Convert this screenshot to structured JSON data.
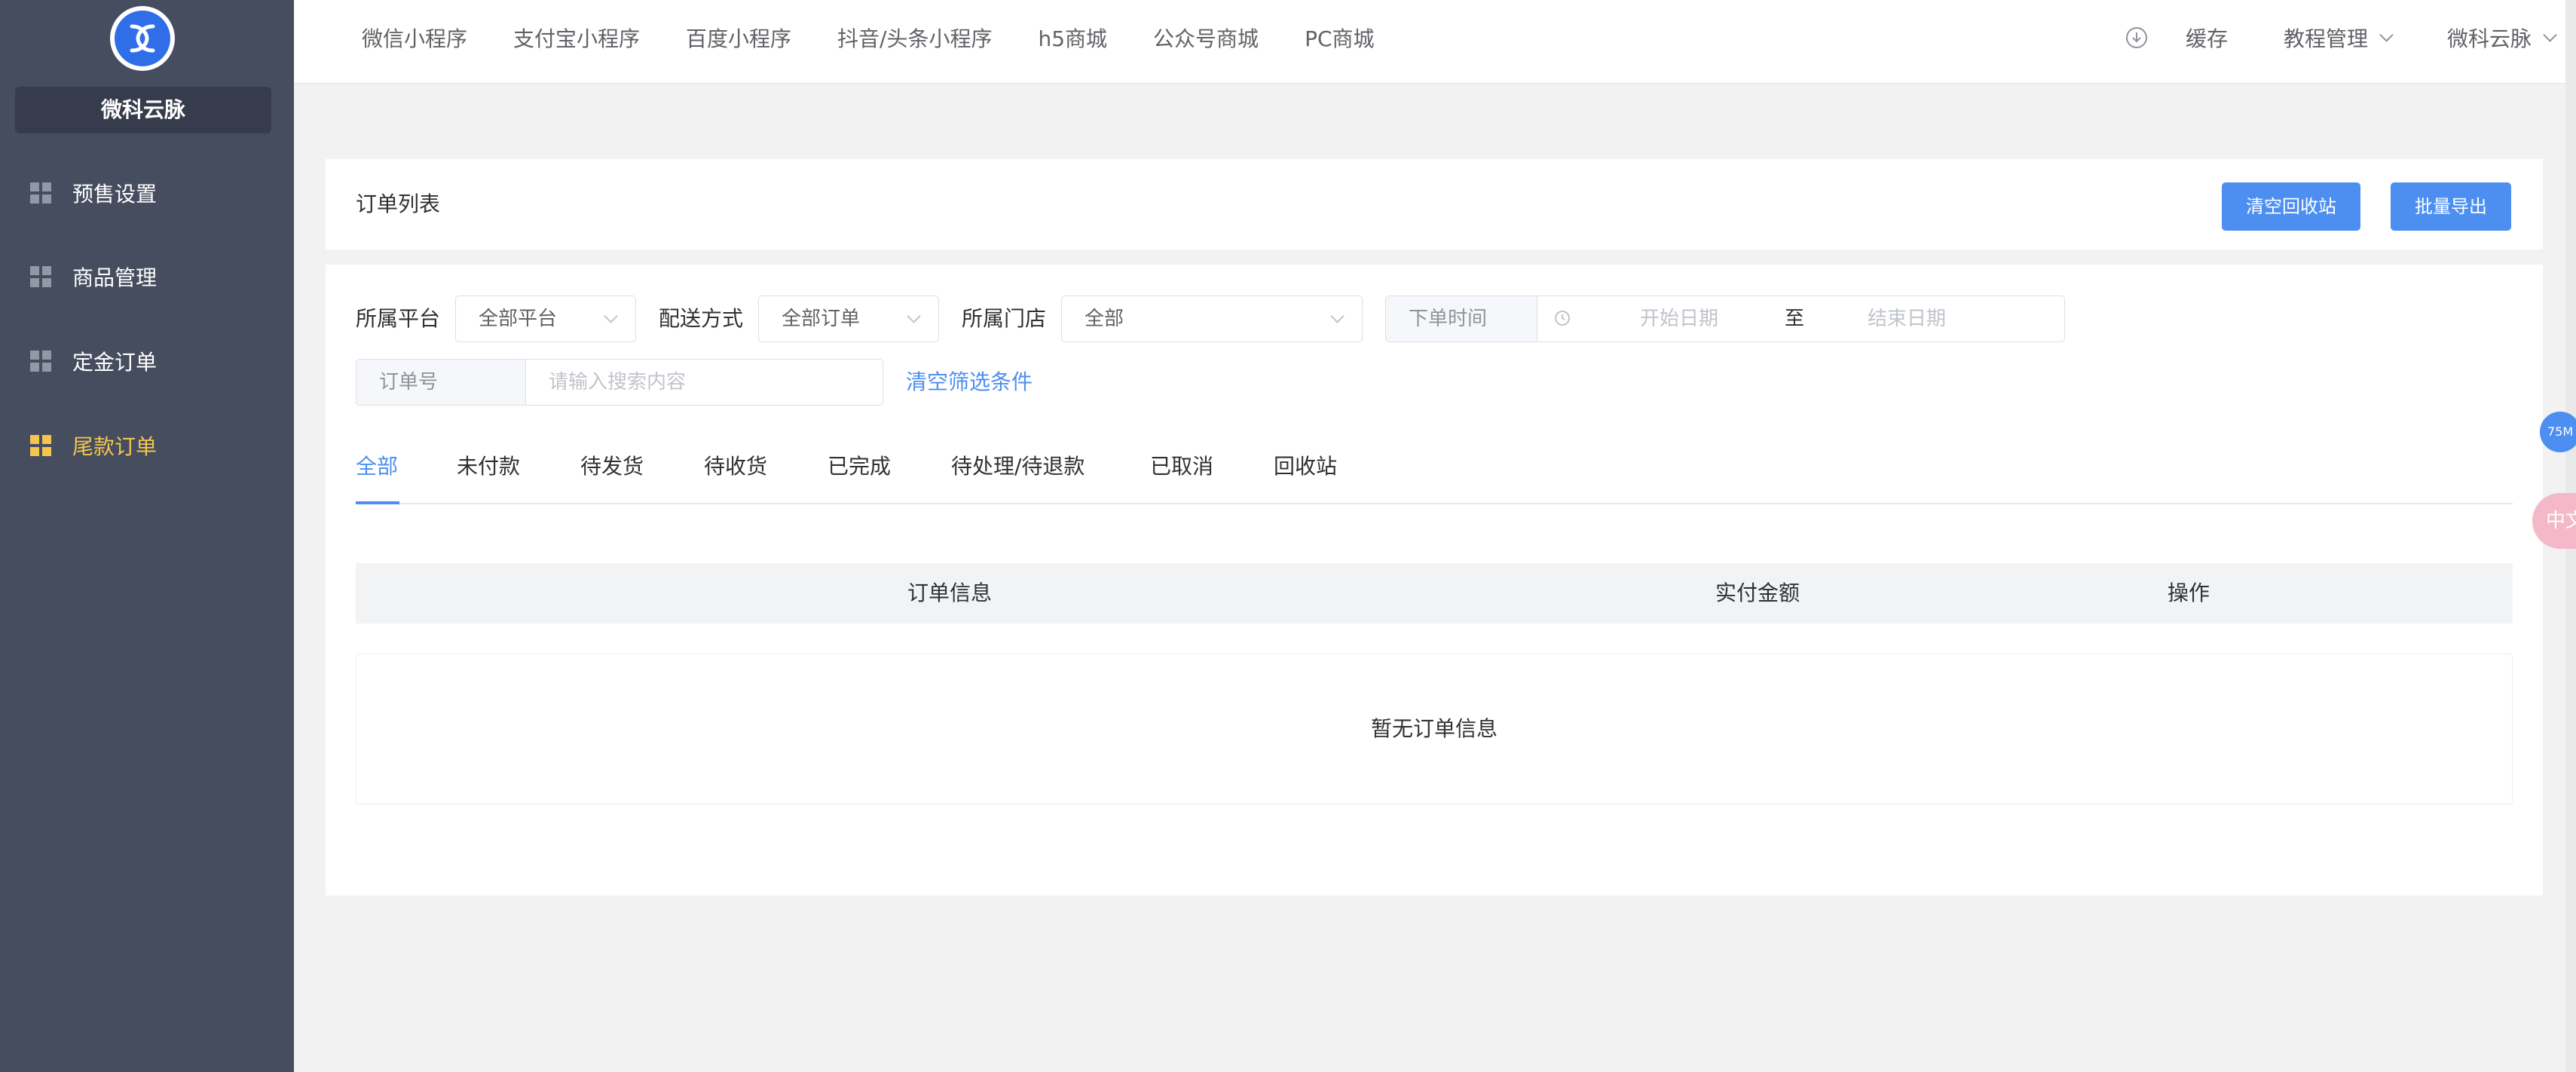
{
  "sidebar": {
    "brand": "微科云脉",
    "items": [
      {
        "label": "预售设置",
        "active": false
      },
      {
        "label": "商品管理",
        "active": false
      },
      {
        "label": "定金订单",
        "active": false
      },
      {
        "label": "尾款订单",
        "active": true
      }
    ]
  },
  "topbar": {
    "nav": [
      "微信小程序",
      "支付宝小程序",
      "百度小程序",
      "抖音/头条小程序",
      "h5商城",
      "公众号商城",
      "PC商城"
    ],
    "cache": "缓存",
    "tutorial": "教程管理",
    "account": "微科云脉"
  },
  "card": {
    "title": "订单列表",
    "btn_clear_recycle": "清空回收站",
    "btn_batch_export": "批量导出"
  },
  "filters": {
    "platform_label": "所属平台",
    "platform_value": "全部平台",
    "delivery_label": "配送方式",
    "delivery_value": "全部订单",
    "store_label": "所属门店",
    "store_value": "全部",
    "time_type": "下单时间",
    "start_placeholder": "开始日期",
    "range_sep": "至",
    "end_placeholder": "结束日期",
    "search_type": "订单号",
    "search_placeholder": "请输入搜索内容",
    "clear_link": "清空筛选条件"
  },
  "tabs": [
    "全部",
    "未付款",
    "待发货",
    "待收货",
    "已完成",
    "待处理/待退款",
    "已取消",
    "回收站"
  ],
  "table": {
    "headers": [
      "订单信息",
      "实付金额",
      "操作"
    ],
    "empty_text": "暂无订单信息"
  },
  "floating": {
    "badge": "75M",
    "translate": "中文"
  },
  "colors": {
    "sidebar_bg": "#464d5f",
    "brand_box": "#363c4c",
    "active_menu": "#f5c54e",
    "primary": "#4c8ff0",
    "page_bg": "#f2f2f2"
  }
}
